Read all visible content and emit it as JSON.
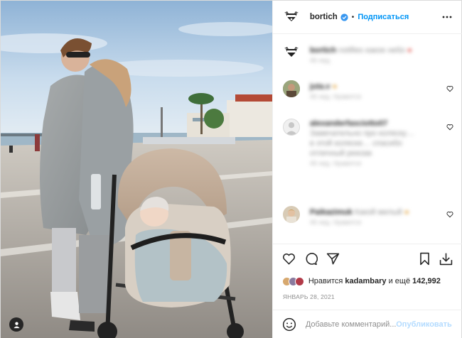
{
  "post": {
    "author": {
      "username": "bortich",
      "verified": true,
      "follow_label": "Подписаться",
      "avatar_icon": "bortich-logo-icon"
    },
    "header": {
      "separator": "•",
      "more_icon": "more-horizontal-icon"
    },
    "comments": [
      {
        "username": "bortich",
        "text": "notifies какое небо",
        "meta": "46 нед.",
        "blurred": true
      },
      {
        "username": "juta.v",
        "text": "",
        "meta": "46 нед.   Нравится",
        "blurred": true
      },
      {
        "username": "alexanderfasciotto07",
        "text": "Замечательно про коляску…",
        "meta": "46 нед.   Нравится",
        "blurred": true
      },
      {
        "username": "Paikazimuk",
        "text": "Какой милый",
        "meta": "46 нед.   Нравится",
        "blurred": true
      }
    ],
    "actions": {
      "like_icon": "heart-icon",
      "comment_icon": "comment-bubble-icon",
      "share_icon": "paper-plane-icon",
      "save_icon": "bookmark-icon",
      "download_icon": "download-icon"
    },
    "likes": {
      "prefix": "Нравится",
      "liked_by": "kadambary",
      "and_more": "и ещё",
      "count": "142,992"
    },
    "date": "ЯНВАРЬ 28, 2021",
    "add_comment": {
      "placeholder": "Добавьте комментарий...",
      "post_label": "Опубликовать",
      "emoji_icon": "emoji-smile-icon"
    },
    "photo": {
      "tag_icon": "user-tag-icon"
    },
    "colors": {
      "accent": "#0095f6",
      "text": "#262626",
      "muted": "#8e8e8e",
      "publish_disabled": "#b3dbff"
    }
  }
}
